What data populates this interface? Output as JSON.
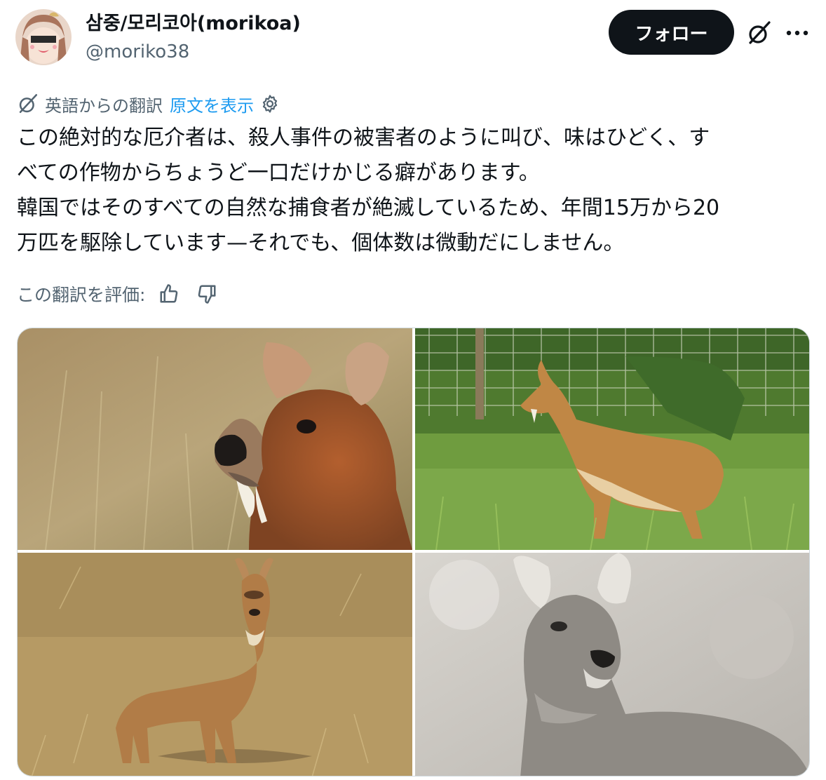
{
  "author": {
    "display_name": "삼중/모리코아(morikoa)",
    "handle": "@moriko38"
  },
  "header": {
    "follow_label": "フォロー",
    "grok_icon": "grok-icon",
    "more_icon": "more-icon"
  },
  "translation": {
    "label": "英語からの翻訳",
    "show_original": "原文を表示",
    "settings_icon": "gear-icon"
  },
  "tweet": {
    "lines": [
      "この絶対的な厄介者は、殺人事件の被害者のように叫び、味はひどく、す",
      "べての作物からちょうど一口だけかじる癖があります。",
      "韓国ではそのすべての自然な捕食者が絶滅しているため、年間15万から20",
      "万匹を駆除しています—それでも、個体数は微動だにしません。"
    ]
  },
  "rating": {
    "label": "この翻訳を評価:",
    "thumbs_up_icon": "thumbs-up-icon",
    "thumbs_down_icon": "thumbs-down-icon"
  },
  "media": {
    "count": 4,
    "photos": [
      "water-deer-closeup",
      "water-deer-in-grass",
      "water-deer-standing-on-dry-grass",
      "water-deer-grayscale-portrait"
    ]
  },
  "colors": {
    "text": "#0f1419",
    "secondary_text": "#536471",
    "link": "#1d9bf0",
    "follow_button_bg": "#0f1419",
    "follow_button_text": "#ffffff",
    "media_border": "#cfd9de"
  }
}
